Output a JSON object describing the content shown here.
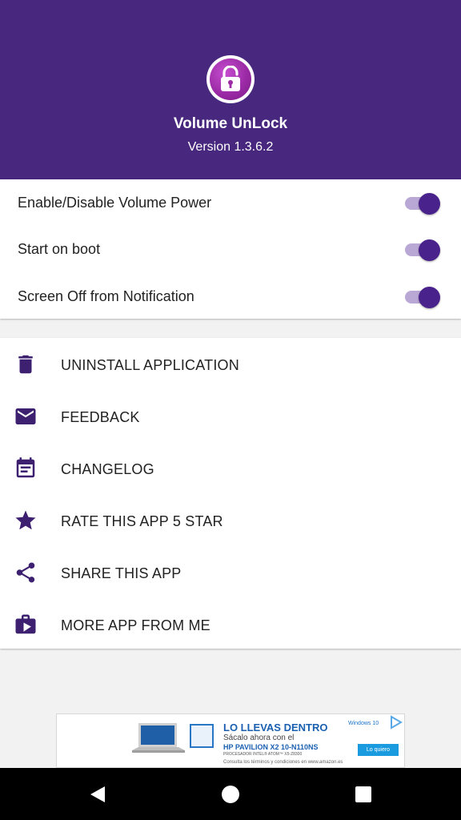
{
  "app": {
    "name": "Volume UnLock",
    "version": "Version 1.3.6.2",
    "logo_icon": "padlock-open-icon"
  },
  "colors": {
    "primary": "#48287e",
    "accent": "#4a228c",
    "switch_track": "#b9a8d6",
    "logo": "#9c2aa6"
  },
  "settings": [
    {
      "label": "Enable/Disable Volume Power",
      "enabled": true
    },
    {
      "label": "Start on boot",
      "enabled": true
    },
    {
      "label": "Screen Off from Notification",
      "enabled": true
    }
  ],
  "menu": [
    {
      "label": "UNINSTALL APPLICATION",
      "icon": "trash-icon"
    },
    {
      "label": "FEEDBACK",
      "icon": "mail-icon"
    },
    {
      "label": "CHANGELOG",
      "icon": "calendar-icon"
    },
    {
      "label": "RATE THIS APP 5 STAR",
      "icon": "star-icon"
    },
    {
      "label": "SHARE THIS APP",
      "icon": "share-icon"
    },
    {
      "label": "MORE APP FROM ME",
      "icon": "store-icon"
    }
  ],
  "ad": {
    "title": "LO LLEVAS DENTRO",
    "subtitle": "Sácalo ahora con el",
    "model": "HP PAVILION X2 10-N110NS",
    "processor": "PROCESADOR INTEL® ATOM™ X5-Z8300",
    "terms": "Consulta los términos y condiciones en www.amazon.es",
    "windows": "Windows 10",
    "button": "Lo quiero"
  },
  "navbar": {
    "back_icon": "back-icon",
    "home_icon": "home-icon",
    "recents_icon": "recents-icon"
  }
}
